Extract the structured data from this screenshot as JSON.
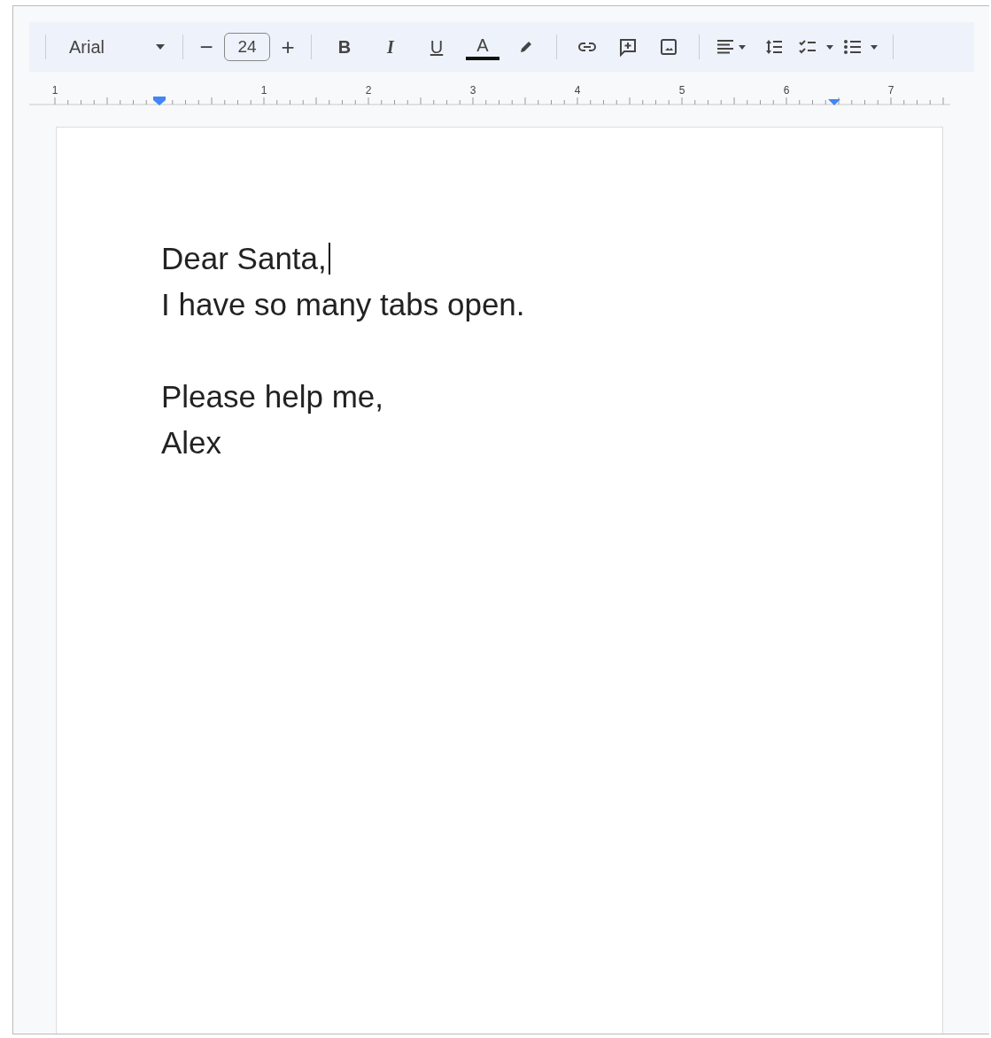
{
  "toolbar": {
    "font": "Arial",
    "size_minus": "−",
    "font_size": "24",
    "size_plus": "+",
    "format_buttons": [
      {
        "kind": "bold",
        "label": "B"
      },
      {
        "kind": "italic",
        "label": "I"
      },
      {
        "kind": "underline",
        "label": "U"
      },
      {
        "kind": "text-color",
        "label": "A"
      }
    ]
  },
  "ruler": {
    "labels": [
      "1",
      "1",
      "2",
      "3",
      "4",
      "5",
      "6",
      "7"
    ]
  },
  "document": {
    "paragraphs": [
      {
        "lines": [
          {
            "text": "Dear Santa,",
            "cursor": true
          },
          {
            "text": "I have so many tabs open.",
            "cursor": false
          }
        ]
      },
      {
        "lines": [
          {
            "text": "Please help me,",
            "cursor": false
          },
          {
            "text": "Alex",
            "cursor": false
          }
        ]
      }
    ]
  }
}
